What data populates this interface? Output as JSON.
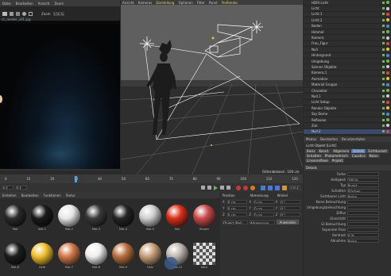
{
  "render_view": {
    "menu": [
      "Datei",
      "Bearbeiten",
      "Ansicht",
      "Zoom",
      "Sonstiges"
    ],
    "zoom_value": "100 %",
    "filename": "cc_render_v01.jpg"
  },
  "viewport": {
    "menu": [
      "Ansicht",
      "Kameras",
      "Darstellung",
      "Optionen",
      "Filter",
      "Panel",
      "ProRender"
    ],
    "label": "Zentralperspektive",
    "grid_label": "Gitterabstand : 100 cm"
  },
  "object_manager": {
    "menu": [
      "Datei",
      "Bearbeiten",
      "Ansicht",
      "Objekte",
      "Tags",
      "Lesezeichen"
    ],
    "items": [
      "HDRI Licht",
      "Licht",
      "Licht.1",
      "Licht.2",
      "Boden",
      "Himmel",
      "Kamera",
      "Frau_Figur",
      "Null",
      "Hintergrund",
      "Umgebung",
      "Szenen Objekte",
      "Kamera.1",
      "Animation",
      "Material Gruppe",
      "Charakter",
      "Null.1",
      "Licht Setup",
      "Render Objekte",
      "Sky Dome",
      "Reflexion",
      "Ziel",
      "Null.2"
    ]
  },
  "attributes": {
    "menu": [
      "Modus",
      "Bearbeiten",
      "Benutzerdaten"
    ],
    "object_label": "Licht-Objekt [Licht]",
    "tabs": [
      "Basis",
      "Koord.",
      "Allgemein",
      "Details",
      "Sichtbarkeit",
      "Schatten",
      "Photometrisch",
      "Caustics",
      "Noise",
      "Linsenreflexe",
      "Projekt"
    ],
    "section_title": "Details",
    "fields": [
      {
        "label": "Farbe",
        "value": ""
      },
      {
        "label": "Helligkeit",
        "value": "100 %"
      },
      {
        "label": "Typ",
        "value": "Punkt"
      },
      {
        "label": "Schatten",
        "value": "Flächen"
      },
      {
        "label": "Sichtbares Licht",
        "value": "Keine"
      },
      {
        "label": "Keine Beleuchtung",
        "value": ""
      },
      {
        "label": "Umgebungsbeleuchtung",
        "value": ""
      },
      {
        "label": "Diffus",
        "value": ""
      },
      {
        "label": "Glanzlicht",
        "value": ""
      },
      {
        "label": "GI Beleuchtung",
        "value": ""
      },
      {
        "label": "Separater Pass",
        "value": ""
      },
      {
        "label": "Kontrast",
        "value": "0 %"
      },
      {
        "label": "Abnahme",
        "value": "Keine"
      }
    ]
  },
  "timeline": {
    "ticks": [
      "0",
      "10",
      "20",
      "30",
      "40",
      "50",
      "60",
      "70",
      "80",
      "90",
      "100",
      "110",
      "120"
    ],
    "frame_start": "0 F",
    "frame_end": "120 F",
    "current_frame": "0 F"
  },
  "materials": {
    "menu": [
      "Erstellen",
      "Bearbeiten",
      "Funktionen",
      "Textur"
    ],
    "items": [
      {
        "name": "Mat",
        "color": "#2a2a2a"
      },
      {
        "name": "Mat.1",
        "color": "#1b1b1b"
      },
      {
        "name": "Mat.2",
        "color": "#e6e6e6"
      },
      {
        "name": "Mat.3",
        "color": "#3a3a3a"
      },
      {
        "name": "Mat.4",
        "color": "#242424"
      },
      {
        "name": "Mat.5",
        "color": "#cfcfcf"
      },
      {
        "name": "Rot",
        "color": "#d8301b"
      },
      {
        "name": "Muster",
        "color": "#c94a4a"
      },
      {
        "name": "Mat.6",
        "color": "#1d1d1d"
      },
      {
        "name": "Gelb",
        "color": "#f0c030"
      },
      {
        "name": "Mat.7",
        "color": "#d07a4a"
      },
      {
        "name": "Mat.8",
        "color": "#eee"
      },
      {
        "name": "Mat.9",
        "color": "#b87040"
      },
      {
        "name": "Holz",
        "color": "#c8a07a"
      },
      {
        "name": "Mat.10",
        "color": "#bfb7b0"
      },
      {
        "name": "Karo",
        "color": "#888"
      }
    ]
  },
  "coordinates": {
    "headers": [
      "Position",
      "Abmessung",
      "Winkel"
    ],
    "rows": [
      {
        "axis": "X",
        "pos": "0 cm",
        "size": "0 cm",
        "angle": "0 °"
      },
      {
        "axis": "Y",
        "pos": "0 cm",
        "size": "0 cm",
        "angle": "0 °"
      },
      {
        "axis": "Z",
        "pos": "0 cm",
        "size": "0 cm",
        "angle": "0 °"
      }
    ],
    "mode": "Objekt (Rel)",
    "size_mode": "Abmessung",
    "apply": "Anwenden"
  }
}
